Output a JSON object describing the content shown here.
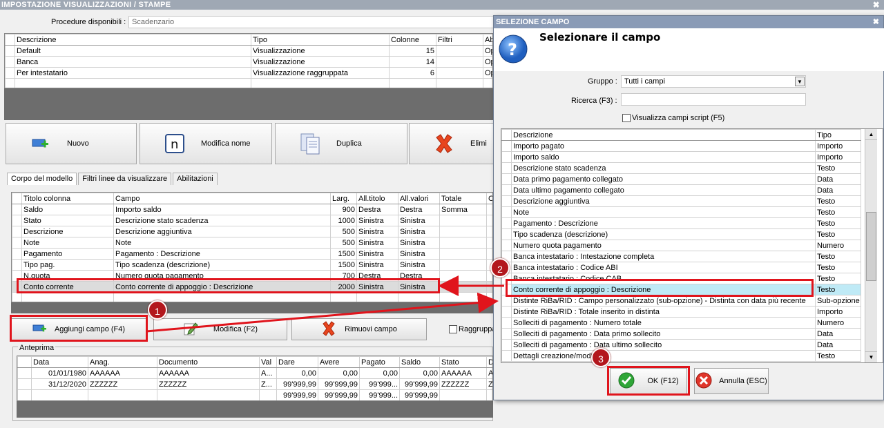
{
  "window": {
    "title": "IMPOSTAZIONE VISUALIZZAZIONI / STAMPE",
    "close": "✖"
  },
  "procedure": {
    "label": "Procedure disponibili :",
    "value": "Scadenzario"
  },
  "proc_table": {
    "headers": [
      "Descrizione",
      "Tipo",
      "Colonne",
      "Filtri",
      "Abi"
    ],
    "rows": [
      [
        "Default",
        "Visualizzazione",
        "15",
        "",
        "Op"
      ],
      [
        "Banca",
        "Visualizzazione",
        "14",
        "",
        "Op"
      ],
      [
        "Per intestatario",
        "Visualizzazione raggruppata",
        "6",
        "",
        "Op"
      ],
      [
        "",
        "",
        "",
        "",
        ""
      ]
    ]
  },
  "toolbar": {
    "nuovo": "Nuovo",
    "modifica_nome": "Modifica nome",
    "duplica": "Duplica",
    "elimina": "Elimi"
  },
  "tabs": [
    "Corpo del modello",
    "Filtri linee da visualizzare",
    "Abilitazioni"
  ],
  "cols_table": {
    "headers": [
      "Titolo colonna",
      "Campo",
      "Larg.",
      "All.titolo",
      "All.valori",
      "Totale",
      "C"
    ],
    "rows": [
      [
        "Saldo",
        "Importo saldo",
        "900",
        "Destra",
        "Destra",
        "Somma",
        ""
      ],
      [
        "Stato",
        "Descrizione stato scadenza",
        "1000",
        "Sinistra",
        "Sinistra",
        "",
        ""
      ],
      [
        "Descrizione",
        "Descrizione aggiuntiva",
        "500",
        "Sinistra",
        "Sinistra",
        "",
        ""
      ],
      [
        "Note",
        "Note",
        "500",
        "Sinistra",
        "Sinistra",
        "",
        ""
      ],
      [
        "Pagamento",
        "Pagamento : Descrizione",
        "1500",
        "Sinistra",
        "Sinistra",
        "",
        ""
      ],
      [
        "Tipo pag.",
        "Tipo scadenza (descrizione)",
        "1500",
        "Sinistra",
        "Sinistra",
        "",
        ""
      ],
      [
        "N.quota",
        "Numero quota pagamento",
        "700",
        "Destra",
        "Destra",
        "",
        ""
      ],
      [
        "Conto corrente",
        "Conto corrente di appoggio : Descrizione",
        "2000",
        "Sinistra",
        "Sinistra",
        "",
        ""
      ],
      [
        "",
        "",
        "",
        "",
        "",
        "",
        ""
      ]
    ]
  },
  "actions": {
    "aggiungi": "Aggiungi campo (F4)",
    "modifica": "Modifica (F2)",
    "rimuovi": "Rimuovi campo",
    "raggruppa": "Raggruppa"
  },
  "preview": {
    "label": "Anteprima",
    "headers": [
      "Data",
      "Anag.",
      "Documento",
      "Val",
      "Dare",
      "Avere",
      "Pagato",
      "Saldo",
      "Stato",
      "De"
    ],
    "rows": [
      [
        "01/01/1980",
        "AAAAAA",
        "AAAAAA",
        "A...",
        "0,00",
        "0,00",
        "0,00",
        "0,00",
        "AAAAAA",
        "AA"
      ],
      [
        "31/12/2020",
        "ZZZZZZ",
        "ZZZZZZ",
        "Z...",
        "99'999,99",
        "99'999,99",
        "99'999...",
        "99'999,99",
        "ZZZZZZ",
        "ZZ"
      ],
      [
        "",
        "",
        "",
        "",
        "99'999,99",
        "99'999,99",
        "99'999...",
        "99'999,99",
        "",
        ""
      ]
    ]
  },
  "dialog": {
    "title": "SELEZIONE CAMPO",
    "close": "✖",
    "heading": "Selezionare il campo",
    "gruppo_label": "Gruppo :",
    "gruppo_value": "Tutti i campi",
    "ricerca_label": "Ricerca (F3) :",
    "ricerca_value": "",
    "script_label": "Visualizza campi script (F5)",
    "headers": [
      "Descrizione",
      "Tipo"
    ],
    "rows": [
      [
        "Importo pagato",
        "Importo"
      ],
      [
        "Importo saldo",
        "Importo"
      ],
      [
        "Descrizione stato scadenza",
        "Testo"
      ],
      [
        "Data primo pagamento collegato",
        "Data"
      ],
      [
        "Data ultimo pagamento collegato",
        "Data"
      ],
      [
        "Descrizione aggiuntiva",
        "Testo"
      ],
      [
        "Note",
        "Testo"
      ],
      [
        "Pagamento : Descrizione",
        "Testo"
      ],
      [
        "Tipo scadenza (descrizione)",
        "Testo"
      ],
      [
        "Numero quota pagamento",
        "Numero"
      ],
      [
        "Banca intestatario : Intestazione completa",
        "Testo"
      ],
      [
        "Banca intestatario : Codice ABI",
        "Testo"
      ],
      [
        "Banca intestatario : Codice CAB",
        "Testo"
      ],
      [
        "Conto corrente di appoggio : Descrizione",
        "Testo"
      ],
      [
        "Distinte RiBa/RID : Campo personalizzato (sub-opzione) - Distinta con data più recente",
        "Sub-opzione"
      ],
      [
        "Distinte RiBa/RID : Totale inserito in distinta",
        "Importo"
      ],
      [
        "Solleciti di pagamento : Numero totale",
        "Numero"
      ],
      [
        "Solleciti di pagamento : Data primo sollecito",
        "Data"
      ],
      [
        "Solleciti di pagamento : Data ultimo sollecito",
        "Data"
      ],
      [
        "Dettagli creazione/modifica",
        "Testo"
      ]
    ],
    "ok": "OK (F12)",
    "annulla": "Annulla (ESC)"
  },
  "callouts": [
    "1",
    "2",
    "3"
  ],
  "colors": {
    "callout_red": "#e0141c",
    "highlight": "#bfeaf6",
    "dark_panel": "#6d6d6d"
  }
}
